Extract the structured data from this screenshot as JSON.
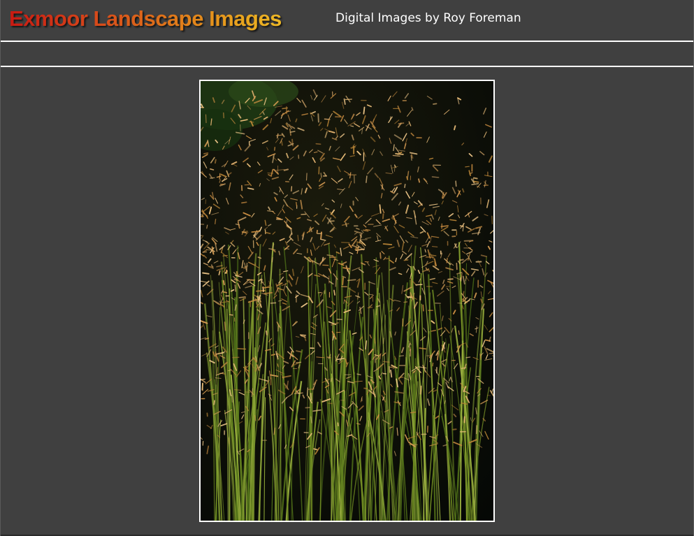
{
  "header": {
    "title": "Exmoor Landscape Images",
    "tagline": "Digital Images by Roy Foreman"
  },
  "photo": {
    "subject": "ornamental-grass-photo"
  },
  "colors": {
    "background": "#404040",
    "title_start": "#c81a12",
    "title_end": "#eeb826",
    "rule": "#ffffff",
    "frame": "#ffffff"
  }
}
